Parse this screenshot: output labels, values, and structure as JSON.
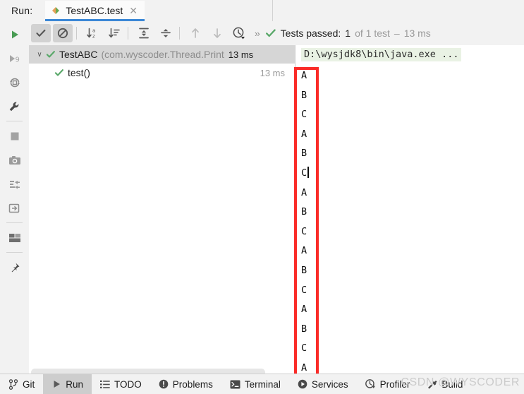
{
  "window": {
    "run_label": "Run:",
    "tab": {
      "title": "TestABC.test",
      "icon": "junit-test-icon",
      "close_icon": "close-icon"
    }
  },
  "rail": {
    "items": [
      {
        "name": "rerun-button",
        "icon": "run-play-icon",
        "label": "Rerun"
      },
      {
        "name": "rerun-failed-tests-button",
        "icon": "rerun-failed-icon",
        "label": "Rerun Failed Tests"
      },
      {
        "name": "toggle-auto-test-button",
        "icon": "auto-test-icon",
        "label": "Toggle auto-test"
      },
      {
        "name": "edit-configurations-button",
        "icon": "wrench-icon",
        "label": "Edit Configurations"
      },
      {
        "name": "stop-button",
        "icon": "stop-square-icon",
        "label": "Stop"
      },
      {
        "name": "screenshot-button",
        "icon": "camera-icon",
        "label": "Screenshot"
      },
      {
        "name": "dump-threads-button",
        "icon": "dump-threads-icon",
        "label": "Dump Threads"
      },
      {
        "name": "export-test-results-button",
        "icon": "export-icon",
        "label": "Export Test Results"
      },
      {
        "name": "layout-settings-button",
        "icon": "layout-icon",
        "label": "Layout Settings"
      },
      {
        "name": "pin-tab-button",
        "icon": "pin-icon",
        "label": "Pin Tab"
      }
    ]
  },
  "toolbar": {
    "buttons": [
      {
        "name": "show-passed-toggle",
        "icon": "check-icon",
        "pressed": true,
        "label": "Show Passed"
      },
      {
        "name": "show-ignored-toggle",
        "icon": "ignored-icon",
        "pressed": true,
        "label": "Show Ignored"
      },
      {
        "name": "sort-alphabetically-button",
        "icon": "sort-alpha-icon",
        "pressed": false,
        "label": "Sort Alphabetically"
      },
      {
        "name": "sort-by-duration-button",
        "icon": "sort-duration-icon",
        "pressed": false,
        "label": "Sort by Duration"
      },
      {
        "name": "expand-all-button",
        "icon": "expand-all-icon",
        "pressed": false,
        "label": "Expand All"
      },
      {
        "name": "collapse-all-button",
        "icon": "collapse-all-icon",
        "pressed": false,
        "label": "Collapse All"
      },
      {
        "name": "previous-failed-test-button",
        "icon": "arrow-up-icon",
        "pressed": false,
        "label": "Previous Failed Test"
      },
      {
        "name": "next-failed-test-button",
        "icon": "arrow-down-icon",
        "pressed": false,
        "label": "Next Failed Test"
      },
      {
        "name": "test-history-button",
        "icon": "history-clock-icon",
        "pressed": false,
        "label": "Test History"
      }
    ],
    "overflow_label": "››"
  },
  "status": {
    "icon": "check-icon",
    "passed_text": "Tests passed:",
    "passed_count": "1",
    "of_text": "of 1 test",
    "dash": "–",
    "duration": "13 ms"
  },
  "test_tree": {
    "rows": [
      {
        "name": "test-class-row",
        "twisty": "∨",
        "icon": "check-icon",
        "title": "TestABC",
        "package": "(com.wyscoder.Thread.Print",
        "time": "13 ms",
        "selected": true,
        "indented": false
      },
      {
        "name": "test-method-row",
        "twisty": "",
        "icon": "check-icon",
        "title": "test()",
        "package": "",
        "time": "13 ms",
        "selected": false,
        "indented": true
      }
    ]
  },
  "console": {
    "command_line": "D:\\wysjdk8\\bin\\java.exe ...",
    "lines": [
      "A",
      "B",
      "C",
      "A",
      "B",
      "C",
      "A",
      "B",
      "C",
      "A",
      "B",
      "C",
      "A",
      "B",
      "C",
      "A"
    ],
    "caret_after_line_index": 5
  },
  "annotation": {
    "name": "red-highlight-box",
    "color": "#fa2b28"
  },
  "statusbar": {
    "items": [
      {
        "name": "statusbar-item-git",
        "icon": "git-branch-icon",
        "label": "Git",
        "active": false
      },
      {
        "name": "statusbar-item-run",
        "icon": "run-play-icon",
        "label": "Run",
        "active": true
      },
      {
        "name": "statusbar-item-todo",
        "icon": "todo-list-icon",
        "label": "TODO",
        "active": false
      },
      {
        "name": "statusbar-item-problems",
        "icon": "problems-icon",
        "label": "Problems",
        "active": false
      },
      {
        "name": "statusbar-item-terminal",
        "icon": "terminal-icon",
        "label": "Terminal",
        "active": false
      },
      {
        "name": "statusbar-item-services",
        "icon": "services-icon",
        "label": "Services",
        "active": false
      },
      {
        "name": "statusbar-item-profiler",
        "icon": "profiler-icon",
        "label": "Profiler",
        "active": false
      },
      {
        "name": "statusbar-item-build",
        "icon": "build-hammer-icon",
        "label": "Build",
        "active": false
      }
    ],
    "watermark": "CSDN @WYSCODER"
  },
  "colors": {
    "accent_blue": "#3b87d6",
    "pass_green": "#59a869",
    "annotation_red": "#fa2b28",
    "console_cmd_bg": "#e9f2e4"
  }
}
